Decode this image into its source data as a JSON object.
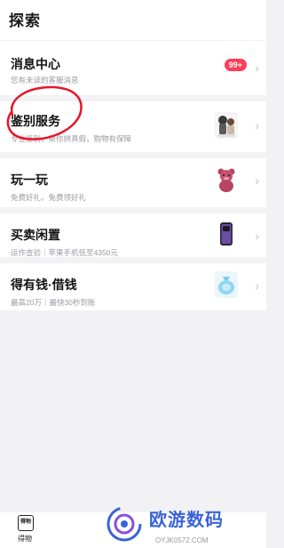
{
  "header": {
    "title": "探索"
  },
  "rows": [
    {
      "title": "消息中心",
      "subtitle": "您有未读的客服消息",
      "badge": "99+",
      "thumb": ""
    },
    {
      "title": "鉴别服务",
      "subtitle": "专业鉴别，帮你辨真假，购物有保障",
      "badge": "",
      "thumb": "sneaker-figure-thumbnail"
    },
    {
      "title": "玩一玩",
      "subtitle": "免费好礼，免费领好礼",
      "badge": "",
      "thumb": "strawberry-bear-toy-thumbnail"
    },
    {
      "title": "买卖闲置",
      "subtitle": "运作查验｜苹果手机低至4350元",
      "badge": "",
      "thumb": "purple-phone-thumbnail"
    },
    {
      "title": "得有钱·借钱",
      "subtitle": "最高20万｜最快30秒到账",
      "badge": "",
      "thumb": "blue-money-bag-thumbnail"
    }
  ],
  "bottom_nav": {
    "tab_icon_text": "得物",
    "tab_label": "得物"
  },
  "watermark": {
    "text": "欧游数码",
    "url": "OYJK0572.COM"
  },
  "colors": {
    "badge": "#ff3d5a",
    "annotation_circle": "#e8142a",
    "watermark": "#3a63d9"
  }
}
